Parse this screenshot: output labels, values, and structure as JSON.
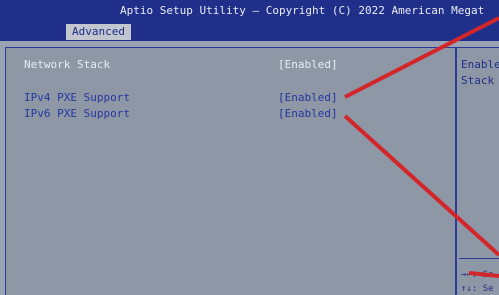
{
  "header": {
    "title": "Aptio Setup Utility – Copyright (C) 2022 American Megat"
  },
  "tabs": [
    {
      "label": "Advanced",
      "active": true
    }
  ],
  "settings": [
    {
      "label": "Network Stack",
      "value": "[Enabled]"
    },
    {
      "label": "IPv4 PXE Support",
      "value": "[Enabled]"
    },
    {
      "label": "IPv6 PXE Support",
      "value": "[Enabled]"
    }
  ],
  "help": {
    "lines": [
      "Enable",
      "Stack"
    ],
    "keys": [
      "→←: Se",
      "↑↓: Se"
    ]
  },
  "colors": {
    "header_bg": "#1f2f8a",
    "panel_bg": "#8e97a6",
    "highlight_text": "#23379f",
    "annotation_arrow": "#d3262a"
  }
}
